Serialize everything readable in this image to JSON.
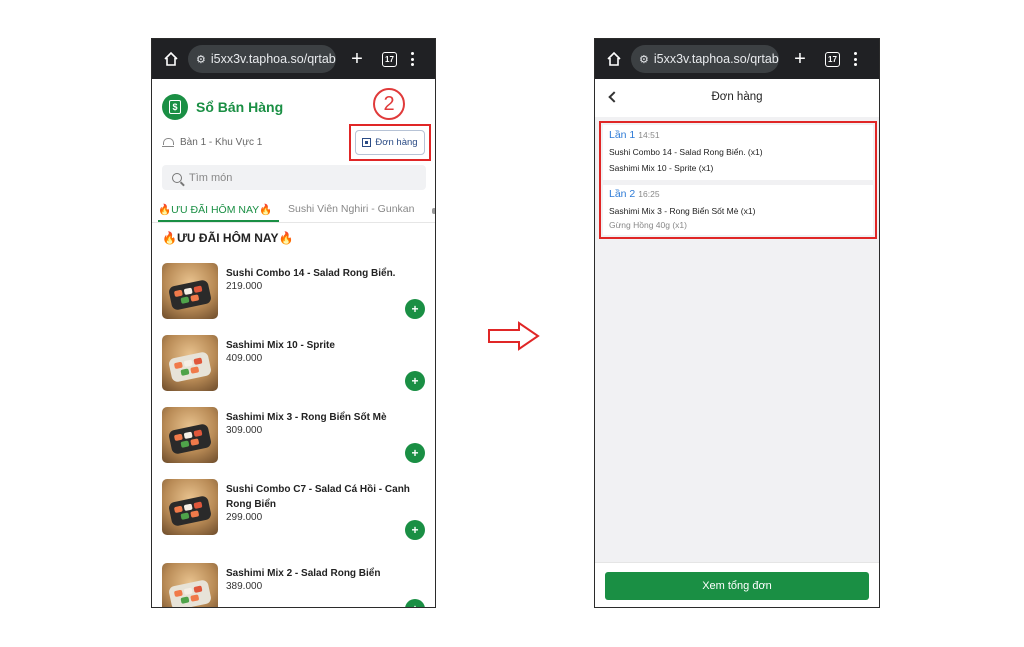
{
  "left_screen": {
    "browser": {
      "url": "i5xx3v.taphoa.so/qrtabl",
      "tab_count": "17",
      "new_tab_label": "+",
      "icons": [
        "home-icon",
        "site-settings-icon",
        "new-tab-icon",
        "tabs-icon",
        "more-menu-icon"
      ]
    },
    "brand_name": "Sổ Bán Hàng",
    "step_number": "2",
    "table_info": "Bàn 1 - Khu Vực 1",
    "order_button_label": "Đơn hàng",
    "search_placeholder": "Tìm món",
    "category_tabs": [
      "🔥ƯU ĐÃI HÔM NAY🔥",
      "Sushi Viên Nghiri - Gunkan"
    ],
    "section_title": "🔥ƯU ĐÃI HÔM NAY🔥",
    "products": [
      {
        "name": "Sushi Combo 14 - Salad Rong Biển.",
        "price": "219.000"
      },
      {
        "name": "Sashimi Mix 10 - Sprite",
        "price": "409.000"
      },
      {
        "name": "Sashimi Mix 3 - Rong Biển Sốt Mè",
        "price": "309.000"
      },
      {
        "name": "Sushi Combo C7 - Salad Cá Hồi - Canh Rong Biển",
        "price": "299.000"
      },
      {
        "name": "Sashimi Mix 2 - Salad Rong Biển",
        "price": "389.000"
      }
    ],
    "add_label": "+"
  },
  "right_screen": {
    "browser": {
      "url": "i5xx3v.taphoa.so/qrtabl",
      "tab_count": "17",
      "new_tab_label": "+"
    },
    "page_title": "Đơn hàng",
    "rounds": [
      {
        "label": "Lần 1",
        "time": "14:51",
        "lines": [
          "Sushi Combo 14 - Salad Rong Biển.  (x1)",
          "Sashimi Mix 10 - Sprite  (x1)"
        ]
      },
      {
        "label": "Lần 2",
        "time": "16:25",
        "lines": [
          "Sashimi Mix 3 - Rong Biển Sốt Mè  (x1)",
          "Gừng Hồng 40g (x1)"
        ]
      }
    ],
    "summary_button_label": "Xem tổng đơn"
  },
  "colors": {
    "brand_green": "#1a8f44",
    "highlight_red": "#e02626",
    "link_blue": "#2e7bd6",
    "browser_bar": "#202124"
  }
}
